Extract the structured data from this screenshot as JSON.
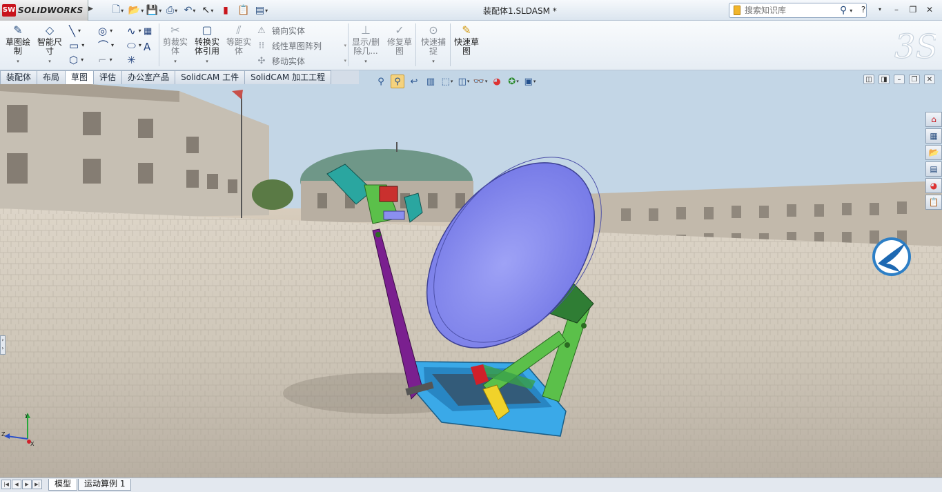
{
  "titlebar": {
    "app_name": "SOLIDWORKS",
    "logo_badge": "SW",
    "document_title": "装配体1.SLDASM *",
    "search_placeholder": "搜索知识库"
  },
  "ribbon": {
    "sketch": "草图绘制",
    "smart_dim": "智能尺寸",
    "trim": "剪裁实体",
    "convert": "转换实体引用",
    "offset": "等距实体",
    "mirror": "镜向实体",
    "pattern": "线性草图阵列",
    "move": "移动实体",
    "show_delete": "显示/删除几...",
    "repair": "修复草图",
    "quick_snap": "快速捕捉",
    "rapid_sketch": "快速草图"
  },
  "tabs": [
    "装配体",
    "布局",
    "草图",
    "评估",
    "办公室产品",
    "SolidCAM 工件",
    "SolidCAM 加工工程"
  ],
  "active_tab_index": 2,
  "bottom_tabs": [
    "模型",
    "运动算例 1"
  ],
  "active_bottom_tab_index": 0,
  "triad": {
    "x": "X",
    "y": "Y",
    "z": "Z"
  },
  "colors": {
    "dish": "#8b8ff0",
    "arm_purple": "#7a1f8f",
    "arm_green": "#5bc04a",
    "base_blue": "#3aa9e8",
    "teal": "#2aa6a0",
    "brand_red": "#c8141b"
  }
}
